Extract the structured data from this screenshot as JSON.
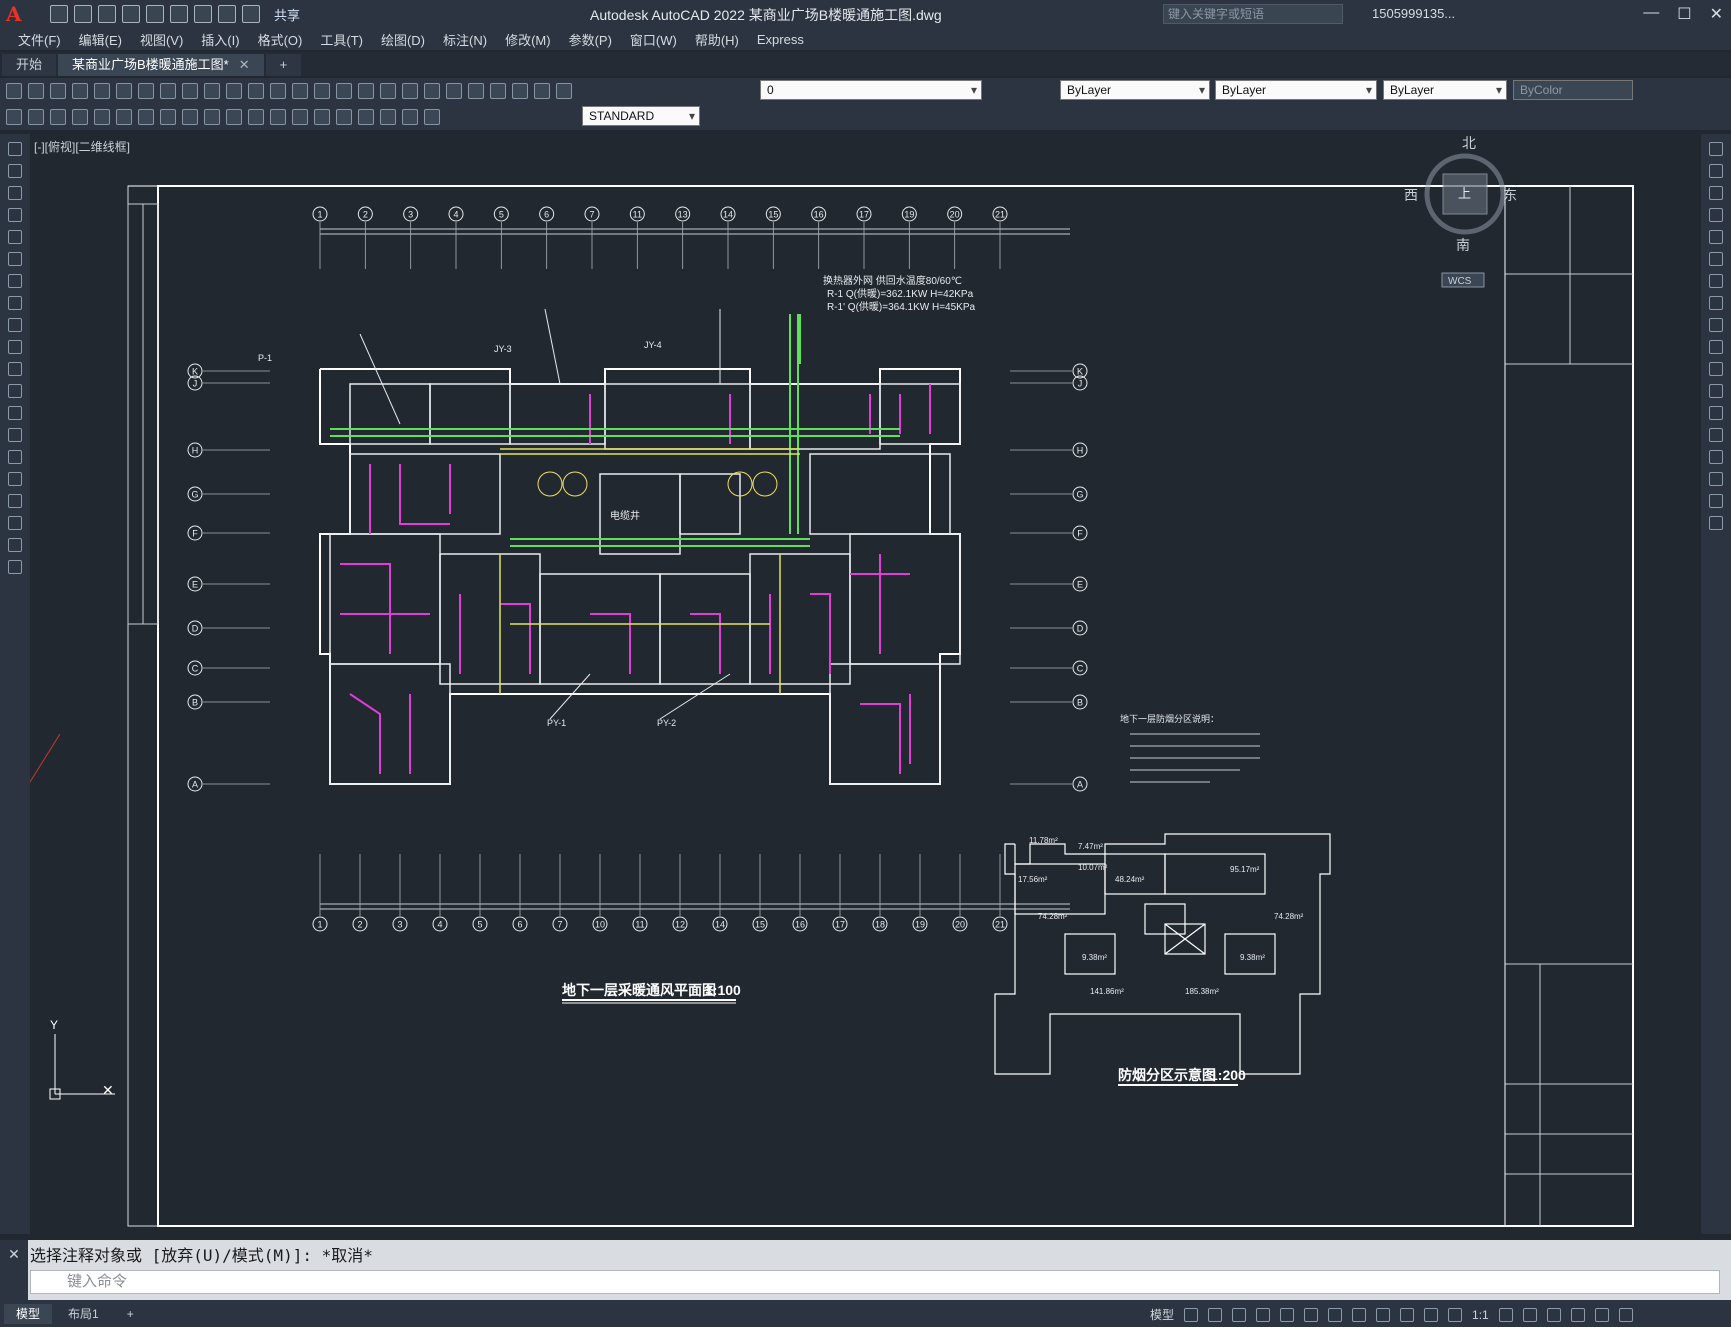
{
  "app": {
    "title": "Autodesk AutoCAD 2022    某商业广场B楼暖通施工图.dwg",
    "share_label": "共享",
    "search_placeholder": "键入关键字或短语",
    "user_label": "1505999135..."
  },
  "menu": [
    "文件(F)",
    "编辑(E)",
    "视图(V)",
    "插入(I)",
    "格式(O)",
    "工具(T)",
    "绘图(D)",
    "标注(N)",
    "修改(M)",
    "参数(P)",
    "窗口(W)",
    "帮助(H)",
    "Express"
  ],
  "tabs": [
    {
      "label": "开始"
    },
    {
      "label": "某商业广场B楼暖通施工图*"
    }
  ],
  "toolbar": {
    "layer_value": "0",
    "color_value": "ByLayer",
    "linetype_value": "ByLayer",
    "lineweight_value": "ByLayer",
    "plotstyle_value": "ByColor",
    "textstyle_value": "STANDARD"
  },
  "viewport": {
    "label": "[-][俯视][二维线框]"
  },
  "drawing": {
    "main_title": "地下一层采暖通风平面图",
    "main_scale": "1:100",
    "sub_title": "防烟分区示意图",
    "sub_scale": "1:200",
    "notes_title": "地下一层防烟分区说明：",
    "heat_note_1": "换热器外网  供回水温度80/60℃",
    "heat_note_2": "R-1  Q(供暖)=362.1KW  H=42KPa",
    "heat_note_3": "R-1'  Q(供暖)=364.1KW  H=45KPa",
    "label_p1": "P-1",
    "label_py1": "PY-1",
    "label_py2": "PY-2",
    "label_elec": "电缆井",
    "label_jy3": "JY-3",
    "label_jy4": "JY-4",
    "area_1": "11.78m²",
    "area_2": "7.47m²",
    "area_3": "17.56m²",
    "area_4": "10.07m²",
    "area_5": "48.24m²",
    "area_6": "95.17m²",
    "area_7": "74.28m²",
    "area_8": "74.28m²",
    "area_9": "9.38m²",
    "area_10": "9.38m²",
    "area_11": "141.86m²",
    "area_12": "185.38m²",
    "compass_n": "北",
    "compass_s": "南",
    "compass_e": "东",
    "compass_w": "西",
    "compass_top": "上",
    "wcs": "WCS"
  },
  "axes_top": [
    "1",
    "2",
    "3",
    "4",
    "5",
    "6",
    "7",
    "11",
    "13",
    "14",
    "15",
    "16",
    "17",
    "19",
    "20",
    "21"
  ],
  "axes_bottom": [
    "1",
    "2",
    "3",
    "4",
    "5",
    "6",
    "7",
    "10",
    "11",
    "12",
    "14",
    "15",
    "16",
    "17",
    "18",
    "19",
    "20",
    "21"
  ],
  "axes_side": [
    "K",
    "J",
    "H",
    "G",
    "F",
    "E",
    "D",
    "C",
    "B",
    "A"
  ],
  "command": {
    "history": "选择注释对象或 [放弃(U)/模式(M)]: *取消*",
    "placeholder": "键入命令"
  },
  "layout_tabs": [
    "模型",
    "布局1"
  ],
  "status": {
    "mode": "模型",
    "scale": "1:1"
  }
}
